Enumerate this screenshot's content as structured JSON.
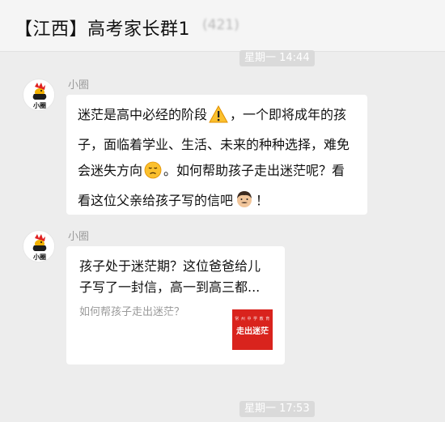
{
  "header": {
    "title": "【江西】高考家长群1",
    "member_count": "(421)"
  },
  "messages": [
    {
      "timestamp": "星期一 14:44",
      "sender": "小圈",
      "avatar_label": "小圈",
      "text_parts": [
        "迷茫是高中必经的阶段",
        "，一个即将成年的孩子，面临着学业、生活、未来的种种选择，难免会迷失方向",
        "。如何帮助孩子走出迷茫呢？看看这位父亲给孩子写的信吧",
        "！"
      ],
      "emojis": [
        "warning-icon",
        "sad-face-icon",
        "man-face-icon"
      ]
    },
    {
      "sender": "小圈",
      "avatar_label": "小圈",
      "card": {
        "title": "孩子处于迷茫期？这位爸爸给儿子写了一封信，高一到高三都...",
        "description": "如何帮孩子走出迷茫？",
        "thumb_top": "常 州 中 学 教 育",
        "thumb_text": "走出迷茫"
      }
    }
  ],
  "timestamps": {
    "second": "星期一 17:53"
  },
  "colors": {
    "bubble_bg": "#ffffff",
    "chat_bg": "#ededed",
    "thumb_red": "#d9231d"
  }
}
